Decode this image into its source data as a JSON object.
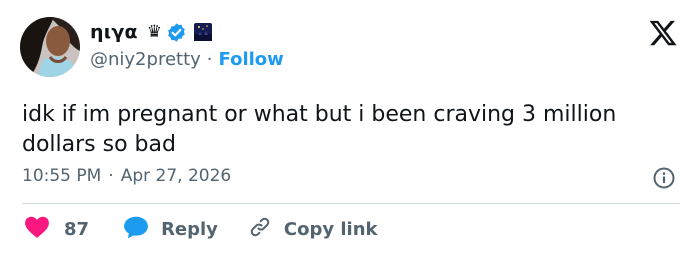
{
  "user": {
    "display_name": "ηιγα",
    "crown": "♛",
    "verified_icon": "verified-badge-icon",
    "emoji_icon": "night-sky-emoji-icon",
    "handle": "@niy2pretty",
    "separator": "·",
    "follow_label": "Follow"
  },
  "tweet": {
    "text": "idk if im pregnant or what but i been craving 3 million dollars so bad",
    "time": "10:55 PM",
    "separator": "·",
    "date": "Apr 27, 2026"
  },
  "actions": {
    "likes_count": "87",
    "reply_label": "Reply",
    "copy_label": "Copy link"
  },
  "colors": {
    "accent": "#1d9bf0",
    "like": "#f91880",
    "text": "#0f1419",
    "muted": "#536471",
    "divider": "#cfd9de"
  },
  "icons": [
    "x-logo-icon",
    "info-icon",
    "heart-icon",
    "reply-bubble-icon",
    "link-icon"
  ]
}
